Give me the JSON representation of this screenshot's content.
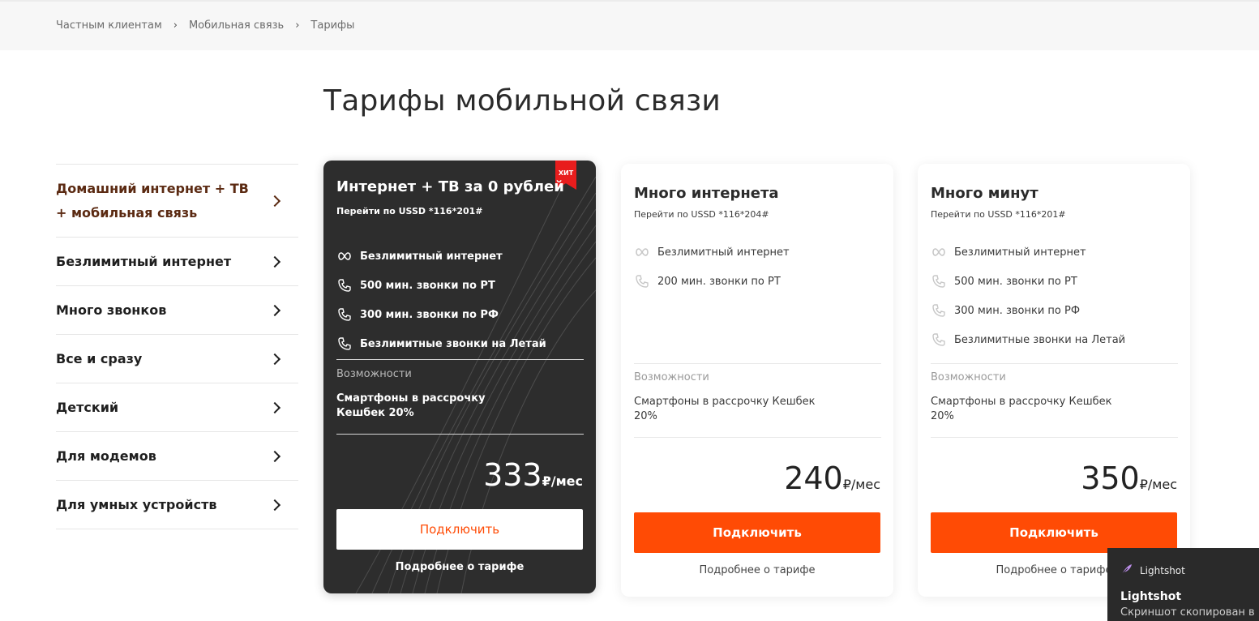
{
  "breadcrumb": [
    {
      "label": "Частным клиентам"
    },
    {
      "label": "Мобильная связь"
    },
    {
      "label": "Тарифы"
    }
  ],
  "page_title": "Тарифы мобильной связи",
  "sidebar": {
    "items": [
      {
        "label": "Домашний интернет + ТВ + мобильная связь",
        "active": true
      },
      {
        "label": "Безлимитный интернет"
      },
      {
        "label": "Много звонков"
      },
      {
        "label": "Все и сразу"
      },
      {
        "label": "Детский"
      },
      {
        "label": "Для модемов"
      },
      {
        "label": "Для умных устройств"
      }
    ]
  },
  "cards": [
    {
      "title": "Интернет + ТВ за 0 рублей",
      "ussd": "Перейти по USSD *116*201#",
      "badge": "ХИТ",
      "features": [
        {
          "icon": "infinity-icon",
          "text": "Безлимитный интернет"
        },
        {
          "icon": "phone-icon",
          "text": "500 мин. звонки по РТ"
        },
        {
          "icon": "phone-icon",
          "text": "300 мин. звонки по РФ"
        },
        {
          "icon": "phone-icon",
          "text": "Безлимитные звонки на Летай"
        }
      ],
      "opportunities_title": "Возможности",
      "opportunities_text": "Смартфоны в рассрочку Кешбек 20%",
      "price": "333",
      "price_unit": "₽/мес",
      "button_label": "Подключить",
      "more_label": "Подробнее о тарифе"
    },
    {
      "title": "Много интернета",
      "ussd": "Перейти по USSD *116*204#",
      "features": [
        {
          "icon": "infinity-icon",
          "text": "Безлимитный интернет"
        },
        {
          "icon": "phone-icon",
          "text": "200 мин. звонки по РТ"
        }
      ],
      "opportunities_title": "Возможности",
      "opportunities_text": "Смартфоны в рассрочку Кешбек 20%",
      "price": "240",
      "price_unit": "₽/мес",
      "button_label": "Подключить",
      "more_label": "Подробнее о тарифе"
    },
    {
      "title": "Много минут",
      "ussd": "Перейти по USSD *116*201#",
      "features": [
        {
          "icon": "infinity-icon",
          "text": "Безлимитный интернет"
        },
        {
          "icon": "phone-icon",
          "text": "500 мин. звонки по РТ"
        },
        {
          "icon": "phone-icon",
          "text": "300 мин. звонки по РФ"
        },
        {
          "icon": "phone-icon",
          "text": "Безлимитные звонки на Летай"
        }
      ],
      "opportunities_title": "Возможности",
      "opportunities_text": "Смартфоны в рассрочку Кешбек 20%",
      "price": "350",
      "price_unit": "₽/мес",
      "button_label": "Подключить",
      "more_label": "Подробнее о тарифе"
    }
  ],
  "toast": {
    "app": "Lightshot",
    "title": "Lightshot",
    "message": "Скриншот скопирован в"
  },
  "colors": {
    "accent": "#ff4b05",
    "dark_card": "#2d2d2d",
    "badge": "#e81d1d",
    "active_sidebar": "#5b2a12"
  }
}
